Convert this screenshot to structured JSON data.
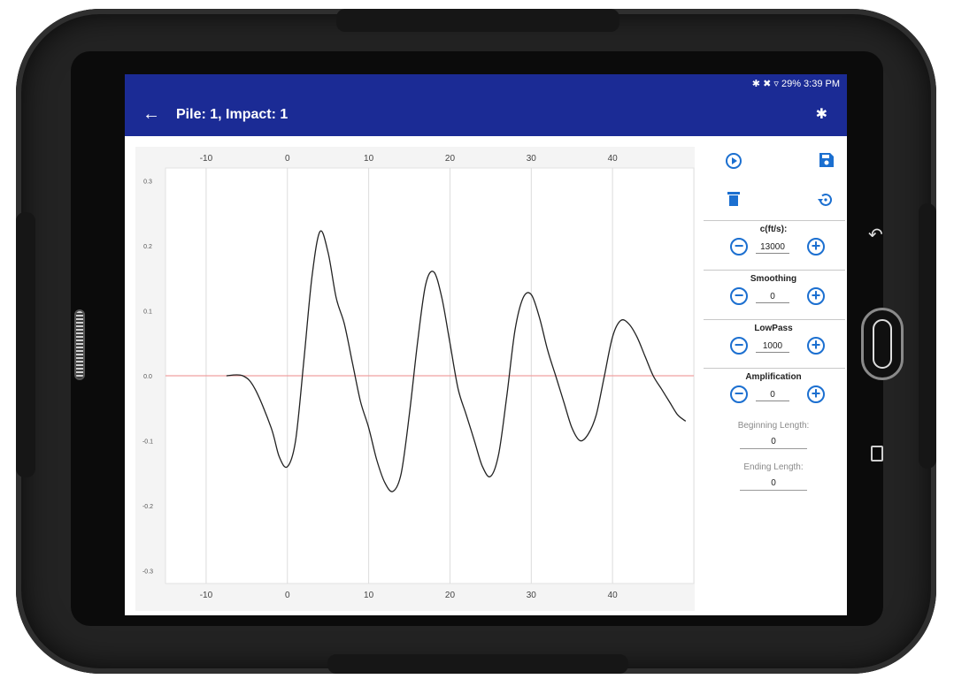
{
  "status": {
    "text": "29% 3:39 PM",
    "icons": [
      "bluetooth-icon",
      "mute-icon",
      "wifi-icon",
      "battery-icon"
    ]
  },
  "appbar": {
    "title": "Pile: 1, Impact: 1",
    "back_icon": "arrow-back-icon",
    "bluetooth_icon": "bluetooth-icon"
  },
  "colors": {
    "primary": "#1b2b95",
    "accent": "#1b6fd0",
    "zero_line": "#f0a0a0",
    "trace": "#222222"
  },
  "chart_data": {
    "type": "line",
    "xlim": [
      -15,
      50
    ],
    "ylim": [
      -0.32,
      0.32
    ],
    "xticks": [
      -10,
      0,
      10,
      20,
      30,
      40
    ],
    "yticks": [
      0.3,
      0.2,
      0.1,
      0.0,
      -0.1,
      -0.2,
      -0.3
    ],
    "ytick_labels": [
      "0.3",
      "0.2",
      "0.1",
      "0.0",
      "-0.1",
      "-0.2",
      "-0.3"
    ],
    "grid": "vertical",
    "zero_line": true,
    "series": [
      {
        "x": [
          -7.5,
          -5.5,
          -4,
          -2,
          -1,
          0,
          1,
          2,
          3,
          4,
          5,
          6,
          7,
          8,
          9,
          10,
          11,
          12,
          13,
          14,
          15,
          16,
          17,
          18,
          19,
          20,
          21,
          22,
          23,
          24,
          25,
          26,
          27,
          28,
          29,
          30,
          31,
          32,
          33,
          34,
          35,
          36,
          37,
          38,
          39,
          40,
          41,
          42,
          43,
          44,
          45,
          46,
          47,
          48,
          49
        ],
        "y": [
          0,
          0,
          -0.02,
          -0.08,
          -0.125,
          -0.14,
          -0.1,
          0.02,
          0.15,
          0.222,
          0.19,
          0.12,
          0.08,
          0.02,
          -0.04,
          -0.08,
          -0.13,
          -0.165,
          -0.178,
          -0.15,
          -0.06,
          0.05,
          0.14,
          0.16,
          0.12,
          0.05,
          -0.02,
          -0.06,
          -0.1,
          -0.14,
          -0.155,
          -0.12,
          -0.03,
          0.07,
          0.12,
          0.125,
          0.09,
          0.04,
          0.0,
          -0.04,
          -0.08,
          -0.1,
          -0.09,
          -0.06,
          0.0,
          0.06,
          0.085,
          0.08,
          0.06,
          0.03,
          0.0,
          -0.02,
          -0.04,
          -0.06,
          -0.07
        ]
      }
    ]
  },
  "panel": {
    "play_icon": "play-circle-icon",
    "save_icon": "save-icon",
    "delete_icon": "trash-icon",
    "reset_icon": "restore-icon",
    "c_label": "c(ft/s):",
    "c_value": "13000",
    "smoothing_label": "Smoothing",
    "smoothing_value": "0",
    "lowpass_label": "LowPass",
    "lowpass_value": "1000",
    "amplification_label": "Amplification",
    "amplification_value": "0",
    "beginning_label": "Beginning Length:",
    "beginning_value": "0",
    "ending_label": "Ending Length:",
    "ending_value": "0",
    "minus_symbol": "−",
    "plus_symbol": "+"
  },
  "device": {
    "nav_back_icon": "nav-back-icon",
    "home_icon": "home-button-icon",
    "recents_icon": "recents-icon"
  }
}
